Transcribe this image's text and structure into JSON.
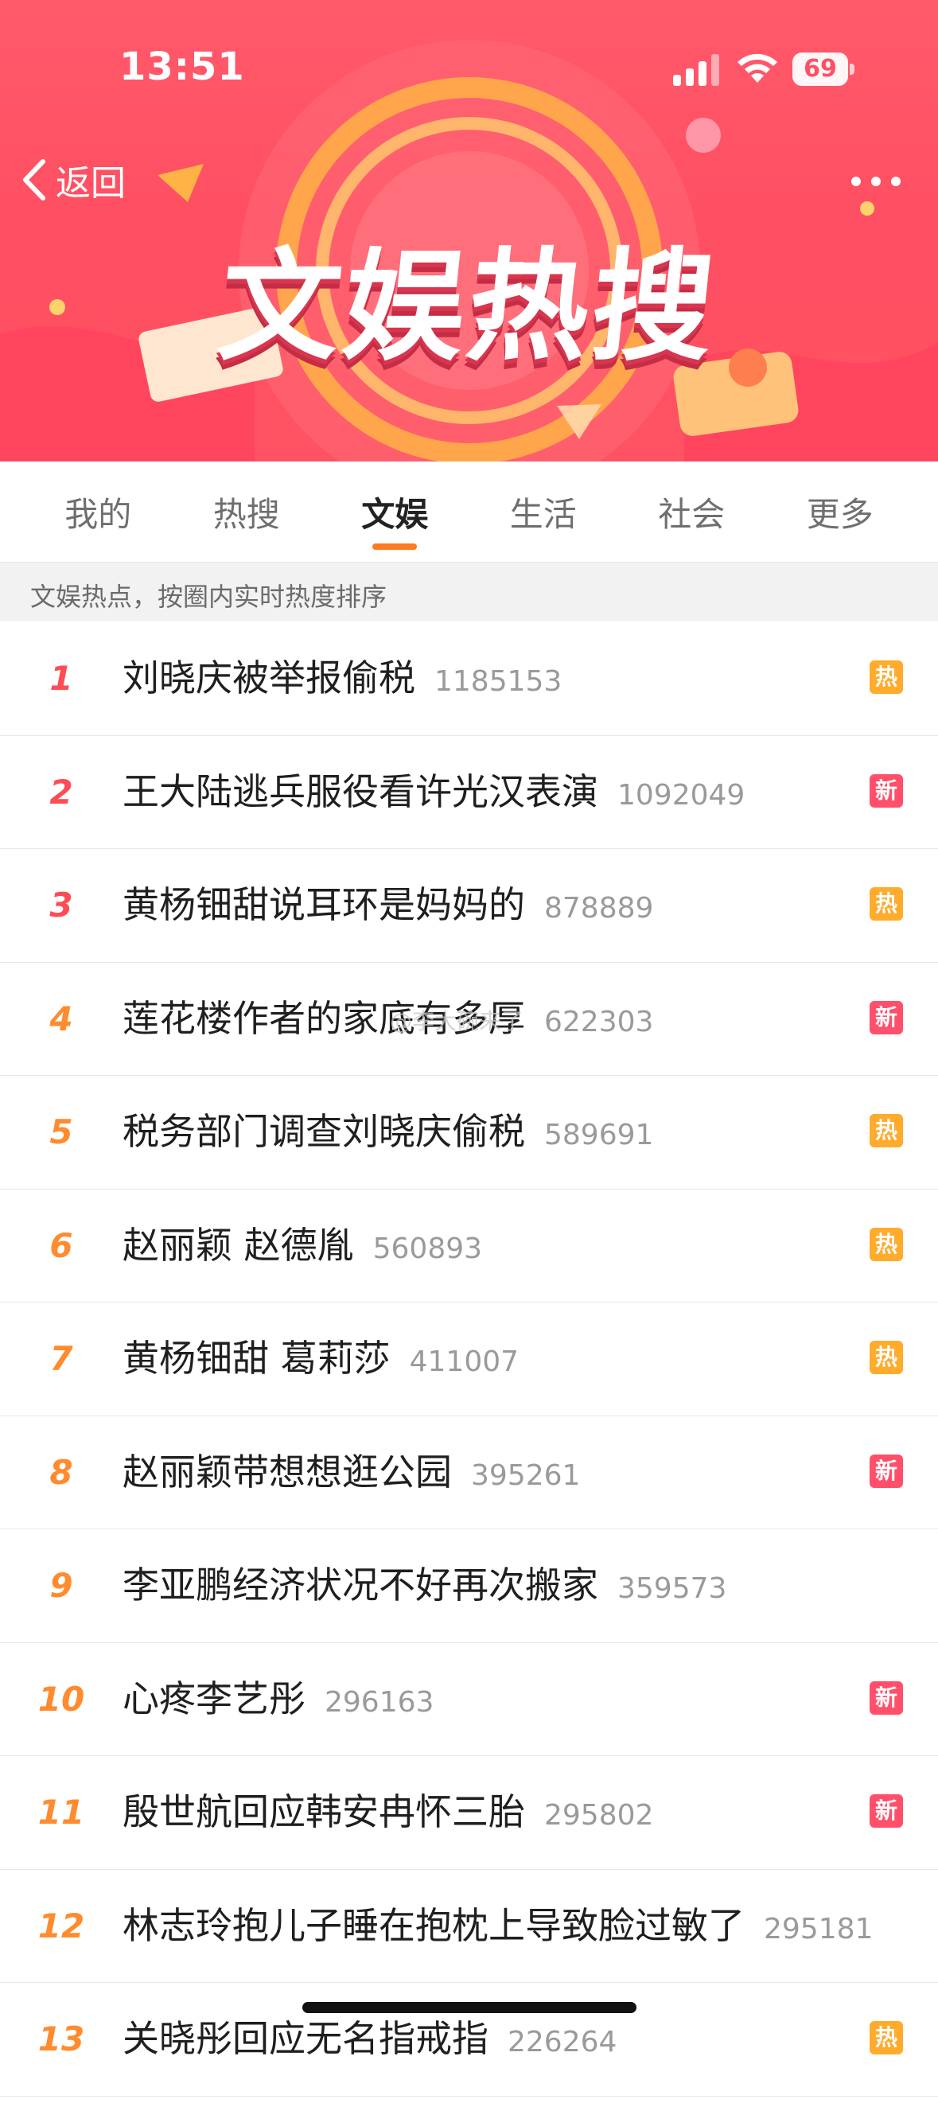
{
  "status": {
    "time": "13:51",
    "battery": "69"
  },
  "nav": {
    "back_label": "返回"
  },
  "banner": {
    "title": "文娱热搜"
  },
  "tabs": [
    {
      "label": "我的"
    },
    {
      "label": "热搜"
    },
    {
      "label": "文娱"
    },
    {
      "label": "生活"
    },
    {
      "label": "社会"
    },
    {
      "label": "更多"
    }
  ],
  "active_tab": "文娱",
  "subtitle": "文娱热点，按圈内实时热度排序",
  "watermark": "@李大碗来了",
  "list": [
    {
      "rank": "1",
      "title": "刘晓庆被举报偷税",
      "count": "1185153",
      "badge": "热",
      "badge_type": "hot"
    },
    {
      "rank": "2",
      "title": "王大陆逃兵服役看许光汉表演",
      "count": "1092049",
      "badge": "新",
      "badge_type": "new"
    },
    {
      "rank": "3",
      "title": "黄杨钿甜说耳环是妈妈的",
      "count": "878889",
      "badge": "热",
      "badge_type": "hot"
    },
    {
      "rank": "4",
      "title": "莲花楼作者的家底有多厚",
      "count": "622303",
      "badge": "新",
      "badge_type": "new"
    },
    {
      "rank": "5",
      "title": "税务部门调查刘晓庆偷税",
      "count": "589691",
      "badge": "热",
      "badge_type": "hot"
    },
    {
      "rank": "6",
      "title": "赵丽颖 赵德胤",
      "count": "560893",
      "badge": "热",
      "badge_type": "hot"
    },
    {
      "rank": "7",
      "title": "黄杨钿甜 葛莉莎",
      "count": "411007",
      "badge": "热",
      "badge_type": "hot"
    },
    {
      "rank": "8",
      "title": "赵丽颖带想想逛公园",
      "count": "395261",
      "badge": "新",
      "badge_type": "new"
    },
    {
      "rank": "9",
      "title": "李亚鹏经济状况不好再次搬家",
      "count": "359573",
      "badge": "",
      "badge_type": ""
    },
    {
      "rank": "10",
      "title": "心疼李艺彤",
      "count": "296163",
      "badge": "新",
      "badge_type": "new"
    },
    {
      "rank": "11",
      "title": "殷世航回应韩安冉怀三胎",
      "count": "295802",
      "badge": "新",
      "badge_type": "new"
    },
    {
      "rank": "12",
      "title": "林志玲抱儿子睡在抱枕上导致脸过敏了",
      "count": "295181",
      "badge": "",
      "badge_type": ""
    },
    {
      "rank": "13",
      "title": "关晓彤回应无名指戒指",
      "count": "226264",
      "badge": "热",
      "badge_type": "hot"
    }
  ]
}
